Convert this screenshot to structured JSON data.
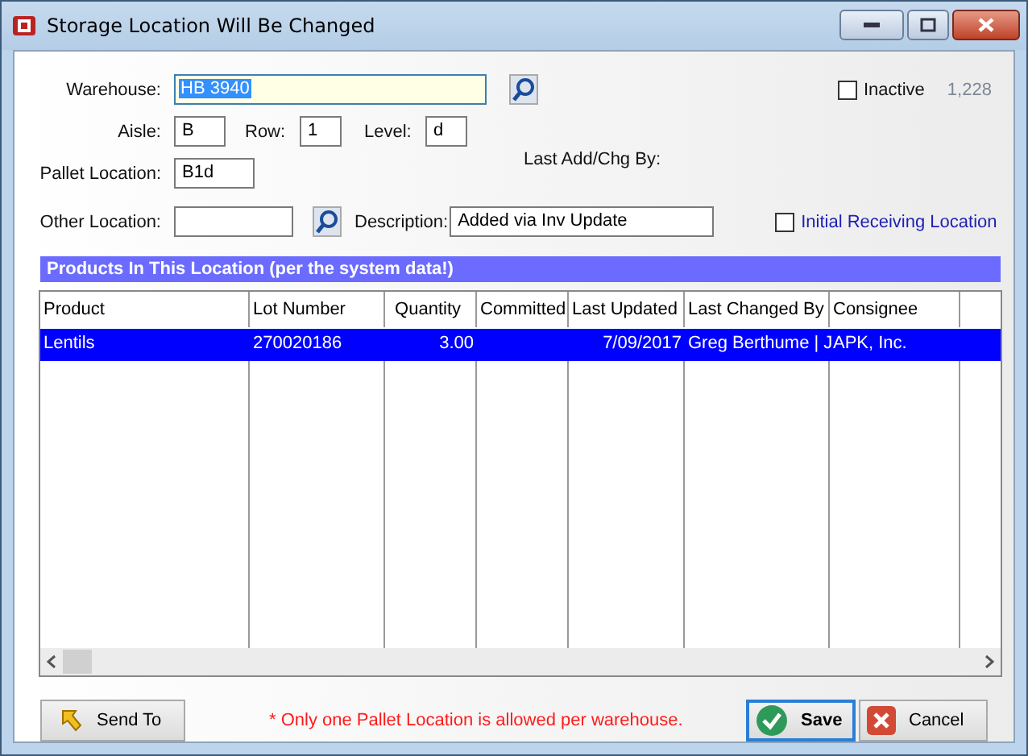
{
  "window": {
    "title": "Storage Location Will Be Changed"
  },
  "form": {
    "warehouse": {
      "label": "Warehouse:",
      "value": "HB 3940"
    },
    "inactive": {
      "label": "Inactive",
      "checked": false
    },
    "count": "1,228",
    "aisle": {
      "label": "Aisle:",
      "value": "B"
    },
    "row": {
      "label": "Row:",
      "value": "1"
    },
    "level": {
      "label": "Level:",
      "value": "d"
    },
    "last_add": {
      "label": "Last Add/Chg By:"
    },
    "pallet_location": {
      "label": "Pallet Location:",
      "value": "B1d"
    },
    "other_location": {
      "label": "Other Location:"
    },
    "description": {
      "label": "Description:",
      "value": "Added via Inv Update"
    },
    "initial_receiving": {
      "label": "Initial Receiving Location",
      "checked": false
    }
  },
  "section_title": "Products In This Location (per the system data!)",
  "table": {
    "columns": [
      "Product",
      "Lot Number",
      "Quantity",
      "Committed",
      "Last Updated",
      "Last Changed By",
      "Consignee"
    ],
    "rows": [
      {
        "cells": [
          "Lentils",
          "270020186",
          "3.00",
          "",
          "7/09/2017",
          "Greg Berthume | J",
          "APK, Inc."
        ],
        "selected": true
      }
    ]
  },
  "footer": {
    "send_to": "Send To",
    "note": "* Only one Pallet Location is allowed per warehouse.",
    "save": "Save",
    "cancel": "Cancel"
  }
}
